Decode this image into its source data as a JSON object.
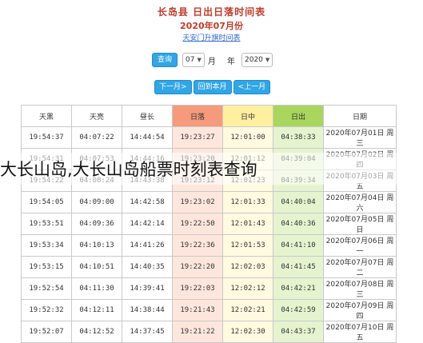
{
  "header": {
    "title": "长岛县 日出日落时间表",
    "subtitle": "2020年07月份",
    "link_prefix": "天安门升旗时间表",
    "link_text": "天安门升旗时间表"
  },
  "controls": {
    "query_button": "查询",
    "year_value": "2020",
    "year_unit": "年",
    "month_value": "07",
    "month_unit": "月"
  },
  "nav": {
    "prev_month": "<上一月",
    "back_this_month": "回到本月",
    "next_month": "下一月>"
  },
  "table": {
    "headers": [
      "日期",
      "日出",
      "日中",
      "日落",
      "昼长",
      "天亮",
      "天黑"
    ],
    "rows": [
      {
        "date": "2020年07月01日 周三",
        "sunrise": "04:38:33",
        "noon": "12:01:00",
        "sunset": "19:23:27",
        "daylength": "14:44:54",
        "dawn": "04:07:22",
        "dusk": "19:54:37"
      },
      {
        "date": "2020年07月02日 周四",
        "sunrise": "04:39:04",
        "noon": "12:01:12",
        "sunset": "19:23:20",
        "daylength": "14:44:16",
        "dawn": "04:07:53",
        "dusk": "19:54:31"
      },
      {
        "date": "2020年07月03日 周五",
        "sunrise": "04:39:34",
        "noon": "12:01:23",
        "sunset": "19:23:12",
        "daylength": "14:43:38",
        "dawn": "04:08:24",
        "dusk": "19:54:22"
      },
      {
        "date": "2020年07月04日 周六",
        "sunrise": "04:40:04",
        "noon": "12:01:33",
        "sunset": "19:23:02",
        "daylength": "14:42:58",
        "dawn": "04:09:00",
        "dusk": "19:54:05"
      },
      {
        "date": "2020年07月05日 周日",
        "sunrise": "04:40:36",
        "noon": "12:01:43",
        "sunset": "19:22:50",
        "daylength": "14:42:14",
        "dawn": "04:09:36",
        "dusk": "19:53:51"
      },
      {
        "date": "2020年07月06日 周一",
        "sunrise": "04:41:10",
        "noon": "12:01:53",
        "sunset": "19:22:36",
        "daylength": "14:41:26",
        "dawn": "04:10:13",
        "dusk": "19:53:34"
      },
      {
        "date": "2020年07月07日 周二",
        "sunrise": "04:41:45",
        "noon": "12:02:03",
        "sunset": "19:22:20",
        "daylength": "14:40:35",
        "dawn": "04:10:51",
        "dusk": "19:53:15"
      },
      {
        "date": "2020年07月08日 周三",
        "sunrise": "04:42:21",
        "noon": "12:02:12",
        "sunset": "19:22:03",
        "daylength": "14:39:41",
        "dawn": "04:11:30",
        "dusk": "19:52:54"
      },
      {
        "date": "2020年07月09日 周四",
        "sunrise": "04:42:59",
        "noon": "12:02:21",
        "sunset": "19:21:43",
        "daylength": "14:38:44",
        "dawn": "04:12:11",
        "dusk": "19:52:32"
      },
      {
        "date": "2020年07月10日 周五",
        "sunrise": "04:43:37",
        "noon": "12:02:30",
        "sunset": "19:21:22",
        "daylength": "14:37:45",
        "dawn": "04:12:52",
        "dusk": "19:52:07"
      }
    ]
  },
  "overlay_text": "大长山岛,大长山岛船票时刻表查询",
  "colors": {
    "accent_button": "#31a6e6",
    "sunrise_header": "#a9d65d",
    "noon_header": "#fff0a0",
    "sunset_header": "#f59a7a",
    "title_red": "#c43b2a"
  }
}
